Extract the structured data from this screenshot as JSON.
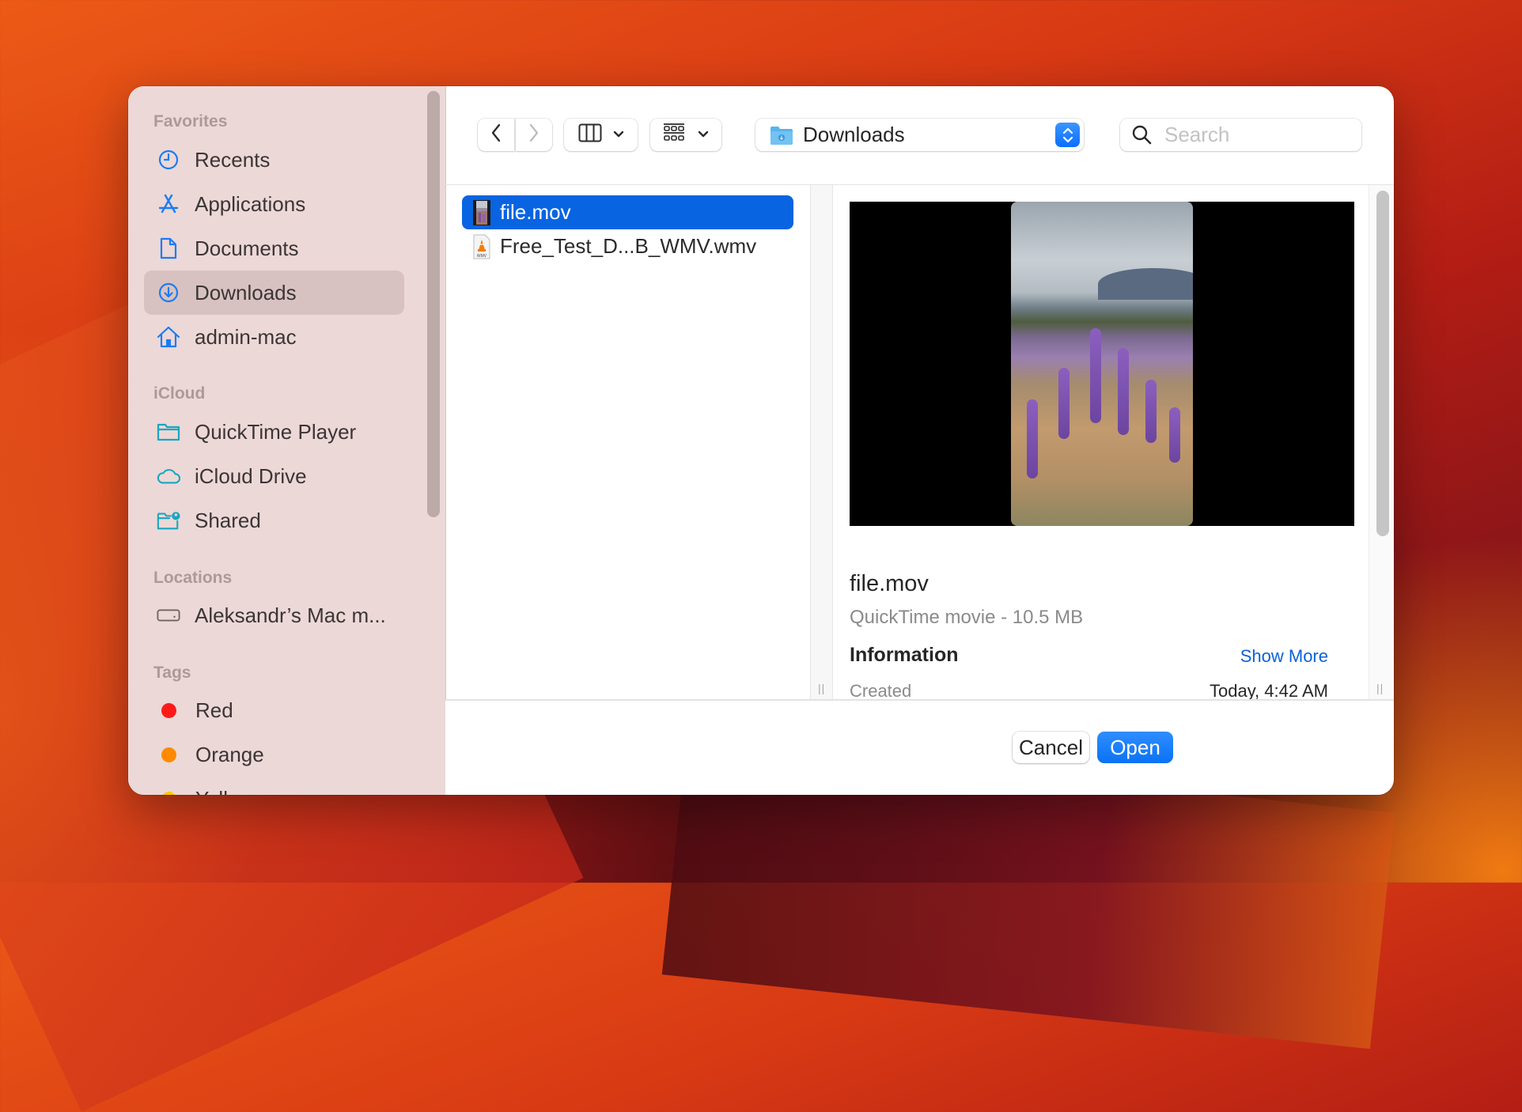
{
  "dialog": {
    "type": "open-file-dialog"
  },
  "sidebar": {
    "sections": [
      {
        "header": "Favorites",
        "items": [
          {
            "label": "Recents",
            "icon": "clock-icon",
            "active": false
          },
          {
            "label": "Applications",
            "icon": "applications-icon",
            "active": false
          },
          {
            "label": "Documents",
            "icon": "document-icon",
            "active": false
          },
          {
            "label": "Downloads",
            "icon": "download-icon",
            "active": true
          },
          {
            "label": "admin-mac",
            "icon": "home-icon",
            "active": false
          }
        ]
      },
      {
        "header": "iCloud",
        "items": [
          {
            "label": "QuickTime Player",
            "icon": "folder-icon"
          },
          {
            "label": "iCloud Drive",
            "icon": "cloud-icon"
          },
          {
            "label": "Shared",
            "icon": "shared-folder-icon"
          }
        ]
      },
      {
        "header": "Locations",
        "items": [
          {
            "label": "Aleksandr’s Mac m...",
            "icon": "disk-icon"
          }
        ]
      },
      {
        "header": "Tags",
        "items": [
          {
            "label": "Red",
            "color": "#ff1a1a"
          },
          {
            "label": "Orange",
            "color": "#ff8a00"
          },
          {
            "label": "Yellow",
            "color": "#ffc800"
          }
        ]
      }
    ]
  },
  "toolbar": {
    "back_icon": "chevron-left-icon",
    "forward_icon": "chevron-right-icon",
    "view_icon": "column-view-icon",
    "group_icon": "group-grid-icon",
    "location": "Downloads",
    "search_placeholder": "Search",
    "search_value": ""
  },
  "files": [
    {
      "name": "file.mov",
      "selected": true,
      "icon": "movie-thumbnail-icon"
    },
    {
      "name": "Free_Test_D...B_WMV.wmv",
      "selected": false,
      "icon": "wmv-file-icon"
    }
  ],
  "preview": {
    "title": "file.mov",
    "subtitle": "QuickTime movie - 10.5 MB",
    "info_header": "Information",
    "show_more": "Show More",
    "rows": [
      {
        "label": "Created",
        "value": "Today, 4:42 AM"
      }
    ]
  },
  "footer": {
    "cancel": "Cancel",
    "open": "Open"
  },
  "colors": {
    "accent": "#0a72f5",
    "selection": "#0964e1",
    "sidebar_bg": "#ecd8d7",
    "link": "#0a62d8"
  }
}
